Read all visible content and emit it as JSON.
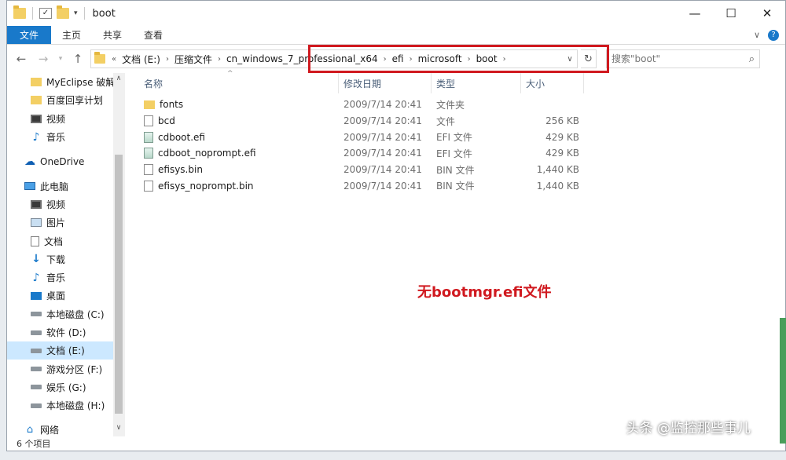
{
  "window": {
    "title": "boot",
    "controls": {
      "minimize": "—",
      "maximize": "☐",
      "close": "✕"
    }
  },
  "ribbon": {
    "tabs": [
      "文件",
      "主页",
      "共享",
      "查看"
    ],
    "expand_glyph": "∨",
    "help_glyph": "?"
  },
  "address": {
    "overflow": "«",
    "crumbs": [
      "文档 (E:)",
      "压缩文件",
      "cn_windows_7_professional_x64",
      "efi",
      "microsoft",
      "boot"
    ],
    "highlight_color": "#d0191f"
  },
  "search": {
    "placeholder": "搜索\"boot\""
  },
  "sidebar": {
    "items": [
      {
        "label": "MyEclipse 破解",
        "icon": "folder-icon"
      },
      {
        "label": "百度回享计划",
        "icon": "folder-icon"
      },
      {
        "label": "视频",
        "icon": "video-icon"
      },
      {
        "label": "音乐",
        "icon": "music-icon"
      },
      {
        "label": "OneDrive",
        "icon": "onedrive-icon"
      },
      {
        "label": "此电脑",
        "icon": "pc-icon"
      },
      {
        "label": "视频",
        "icon": "video-icon"
      },
      {
        "label": "图片",
        "icon": "pictures-icon"
      },
      {
        "label": "文档",
        "icon": "documents-icon"
      },
      {
        "label": "下载",
        "icon": "downloads-icon"
      },
      {
        "label": "音乐",
        "icon": "music-icon"
      },
      {
        "label": "桌面",
        "icon": "desktop-icon"
      },
      {
        "label": "本地磁盘 (C:)",
        "icon": "drive-icon"
      },
      {
        "label": "软件 (D:)",
        "icon": "drive-icon"
      },
      {
        "label": "文档 (E:)",
        "icon": "drive-icon",
        "selected": true
      },
      {
        "label": "游戏分区 (F:)",
        "icon": "drive-icon"
      },
      {
        "label": "娱乐 (G:)",
        "icon": "drive-icon"
      },
      {
        "label": "本地磁盘 (H:)",
        "icon": "drive-icon"
      },
      {
        "label": "网络",
        "icon": "network-icon"
      }
    ]
  },
  "columns": {
    "name": "名称",
    "date": "修改日期",
    "type": "类型",
    "size": "大小"
  },
  "files": [
    {
      "name": "fonts",
      "date": "2009/7/14 20:41",
      "type": "文件夹",
      "size": "",
      "icon": "folder"
    },
    {
      "name": "bcd",
      "date": "2009/7/14 20:41",
      "type": "文件",
      "size": "256 KB",
      "icon": "file"
    },
    {
      "name": "cdboot.efi",
      "date": "2009/7/14 20:41",
      "type": "EFI 文件",
      "size": "429 KB",
      "icon": "efi"
    },
    {
      "name": "cdboot_noprompt.efi",
      "date": "2009/7/14 20:41",
      "type": "EFI 文件",
      "size": "429 KB",
      "icon": "efi"
    },
    {
      "name": "efisys.bin",
      "date": "2009/7/14 20:41",
      "type": "BIN 文件",
      "size": "1,440 KB",
      "icon": "file"
    },
    {
      "name": "efisys_noprompt.bin",
      "date": "2009/7/14 20:41",
      "type": "BIN 文件",
      "size": "1,440 KB",
      "icon": "file"
    }
  ],
  "annotation": "无bootmgr.efi文件",
  "status": "6 个项目",
  "watermark": "头条 @监控那些事儿"
}
